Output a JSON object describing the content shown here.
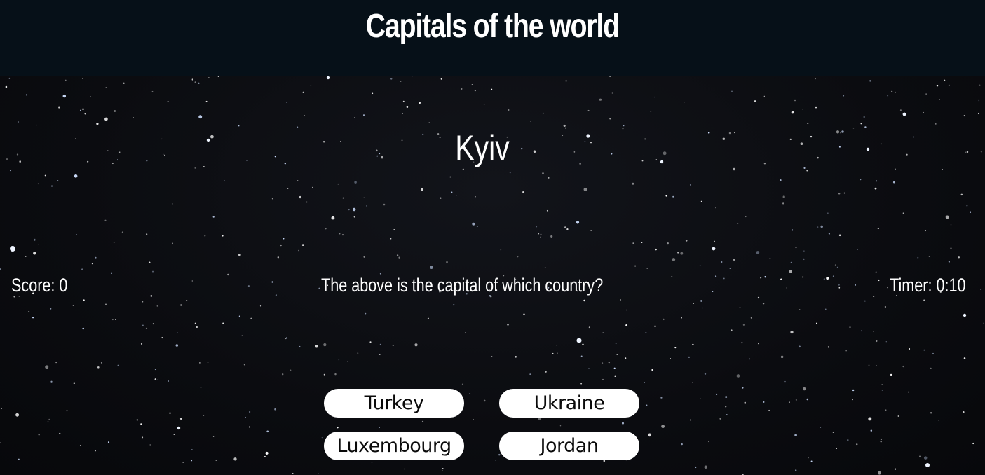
{
  "header": {
    "title": "Capitals of the world"
  },
  "quiz": {
    "capital": "Kyiv",
    "score_text": "Score: 0",
    "question": "The above is the capital of which country?",
    "timer_text": "Timer: 0:10",
    "answers": [
      "Turkey",
      "Ukraine",
      "Luxembourg",
      "Jordan"
    ]
  },
  "colors": {
    "header_bg": "#061018",
    "page_bg": "#0b0c10",
    "button_bg": "#ffffff",
    "button_text": "#0a0a0a",
    "text": "#ffffff"
  }
}
